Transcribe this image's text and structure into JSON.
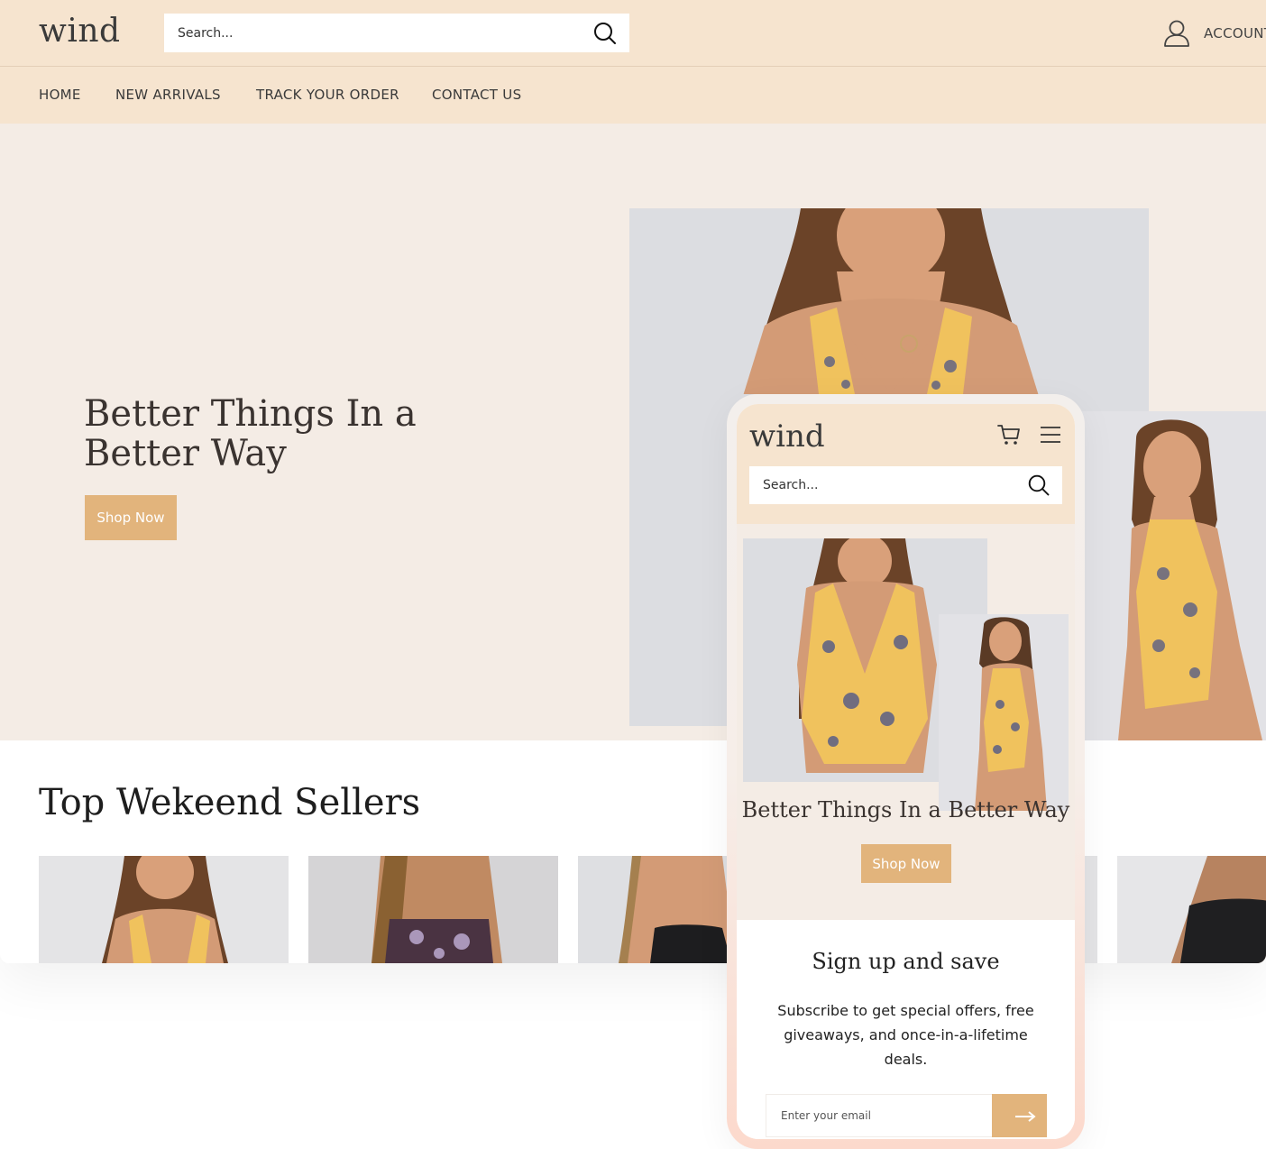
{
  "desktop": {
    "logo": "wind",
    "search": {
      "placeholder": "Search..."
    },
    "account_label": "ACCOUNT",
    "nav": [
      "HOME",
      "NEW ARRIVALS",
      "TRACK YOUR ORDER",
      "CONTACT US"
    ],
    "hero": {
      "title": "Better Things In a Better Way",
      "cta": "Shop Now"
    },
    "sellers": {
      "title": "Top Wekeend Sellers",
      "products": 5
    }
  },
  "mobile": {
    "logo": "wind",
    "search": {
      "placeholder": "Search..."
    },
    "hero": {
      "title": "Better Things In a Better Way",
      "cta": "Shop Now"
    },
    "signup": {
      "title": "Sign up and save",
      "text": "Subscribe to get special offers, free giveaways, and once-in-a-lifetime deals.",
      "email_placeholder": "Enter your email"
    }
  },
  "colors": {
    "header_bg": "#f6e4cf",
    "hero_bg": "#f4ece5",
    "accent": "#e2b47c",
    "photo_bg": "#dcdde1"
  },
  "icons": [
    "search-icon",
    "user-icon",
    "cart-icon",
    "menu-icon",
    "arrow-right-icon"
  ]
}
